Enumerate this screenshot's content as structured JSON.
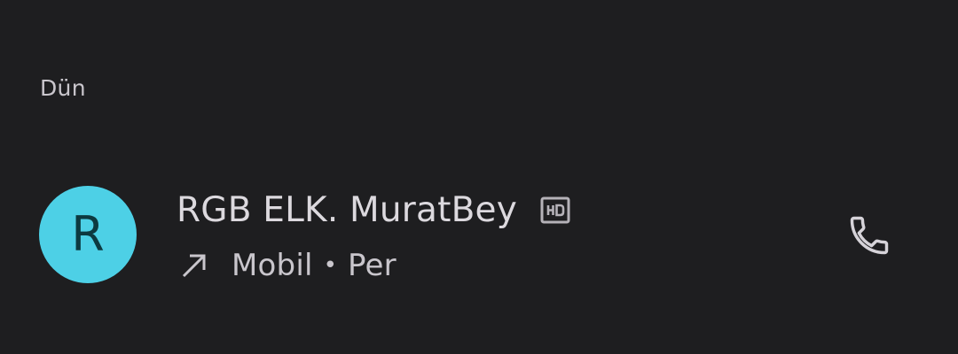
{
  "section": {
    "header": "Dün"
  },
  "call": {
    "avatar_letter": "R",
    "avatar_color": "#4dd0e6",
    "name": "RGB ELK. MuratBey",
    "hd_badge_icon": "hd-icon",
    "direction_icon": "outgoing-call-arrow-icon",
    "type": "Mobil",
    "separator": "•",
    "time": "Per",
    "action_icon": "phone-icon"
  }
}
